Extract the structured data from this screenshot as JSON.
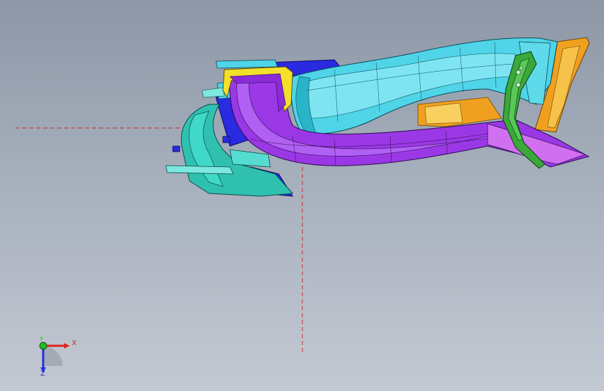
{
  "viewport": {
    "background_top": "#8d97a6",
    "background_bottom": "#c3c9d3",
    "crosshair_color": "#cc2a2a"
  },
  "model": {
    "part_colors": {
      "cyan_duct": "#4fd4e8",
      "purple_duct": "#9a38e6",
      "teal_bracket": "#2fc0b0",
      "green_bracket": "#3aa83a",
      "orange_panel": "#f0a020",
      "yellow_rim": "#f2e02a",
      "blue_parts": "#2a2ae0"
    }
  },
  "triad": {
    "x_label": "X",
    "y_label": "Y",
    "z_label": "Z",
    "x_color": "#e02020",
    "y_color": "#20c020",
    "z_color": "#2030e0"
  }
}
